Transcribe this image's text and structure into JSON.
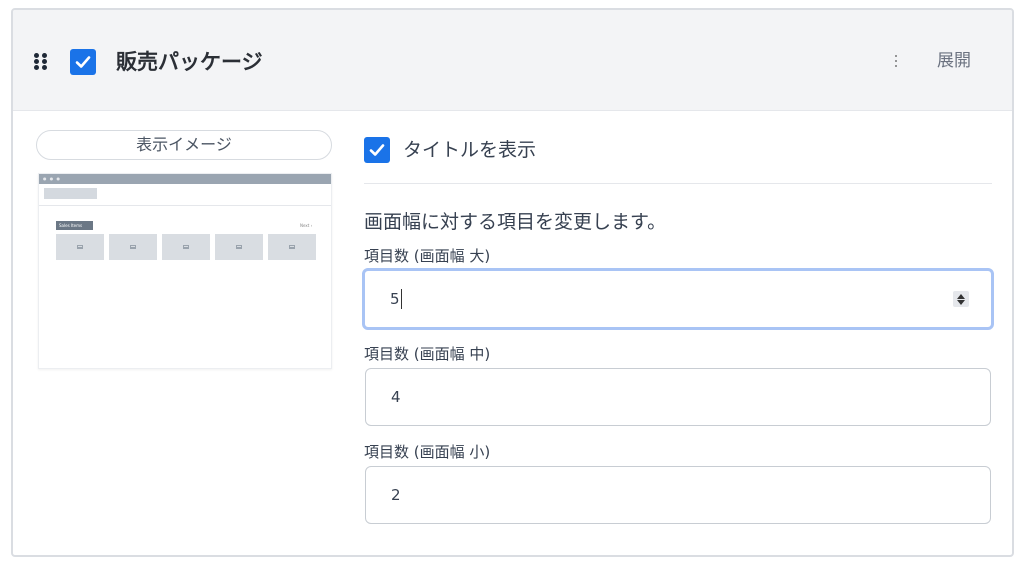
{
  "header": {
    "title": "販売パッケージ",
    "expand_label": "展開",
    "checked": true
  },
  "preview": {
    "label": "表示イメージ",
    "badge_text": "Sales Items",
    "next_text": "Next ›"
  },
  "settings": {
    "show_title_label": "タイトルを表示",
    "show_title_checked": true,
    "description": "画面幅に対する項目を変更します。",
    "fields": [
      {
        "label": "項目数 (画面幅 大)",
        "value": "5"
      },
      {
        "label": "項目数 (画面幅 中)",
        "value": "4"
      },
      {
        "label": "項目数 (画面幅 小)",
        "value": "2"
      }
    ]
  },
  "colors": {
    "accent": "#1a73e8",
    "focus_ring": "#a9c4f5",
    "header_bg": "#f3f4f6"
  },
  "icons": [
    "drag-handle-icon",
    "checkmark-icon",
    "more-vertical-icon",
    "stepper-icon"
  ]
}
